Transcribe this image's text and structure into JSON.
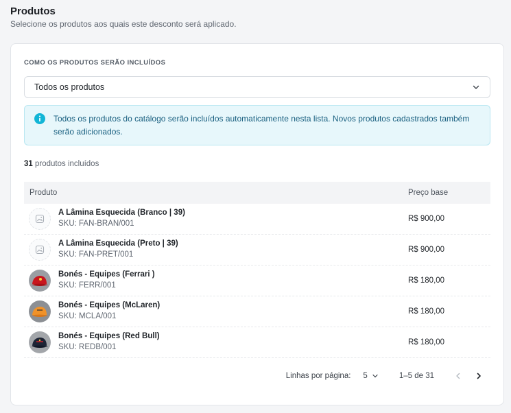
{
  "section": {
    "title": "Produtos",
    "subtitle": "Selecione os produtos aos quais este desconto será aplicado."
  },
  "inclusion": {
    "label": "Como os produtos serão incluídos",
    "selected": "Todos os produtos",
    "icon": "chevron-down-icon"
  },
  "alert": {
    "icon": "info-icon",
    "text": "Todos os produtos do catálogo serão incluídos automaticamente nesta lista. Novos produtos cadastrados também serão adicionados.",
    "color": "#1a6080",
    "background": "#e7f7fb"
  },
  "count": {
    "number": "31",
    "suffix": " produtos incluídos"
  },
  "table": {
    "headers": {
      "product": "Produto",
      "price": "Preço base"
    },
    "rows": [
      {
        "name": "A Lâmina Esquecida (Branco | 39)",
        "sku": "SKU: FAN-BRAN/001",
        "price": "R$ 900,00",
        "thumb": "image-placeholder-icon"
      },
      {
        "name": "A Lâmina Esquecida (Preto | 39)",
        "sku": "SKU: FAN-PRET/001",
        "price": "R$ 900,00",
        "thumb": "image-placeholder-icon"
      },
      {
        "name": "Bonés - Equipes (Ferrari )",
        "sku": "SKU: FERR/001",
        "price": "R$ 180,00",
        "thumb": "red-cap-image"
      },
      {
        "name": "Bonés - Equipes (McLaren)",
        "sku": "SKU: MCLA/001",
        "price": "R$ 180,00",
        "thumb": "orange-cap-image"
      },
      {
        "name": "Bonés - Equipes (Red Bull)",
        "sku": "SKU: REDB/001",
        "price": "R$ 180,00",
        "thumb": "navy-cap-image"
      }
    ]
  },
  "pagination": {
    "rows_per_page_label": "Linhas por página:",
    "rows_per_page": "5",
    "range": "1–5 de 31"
  }
}
